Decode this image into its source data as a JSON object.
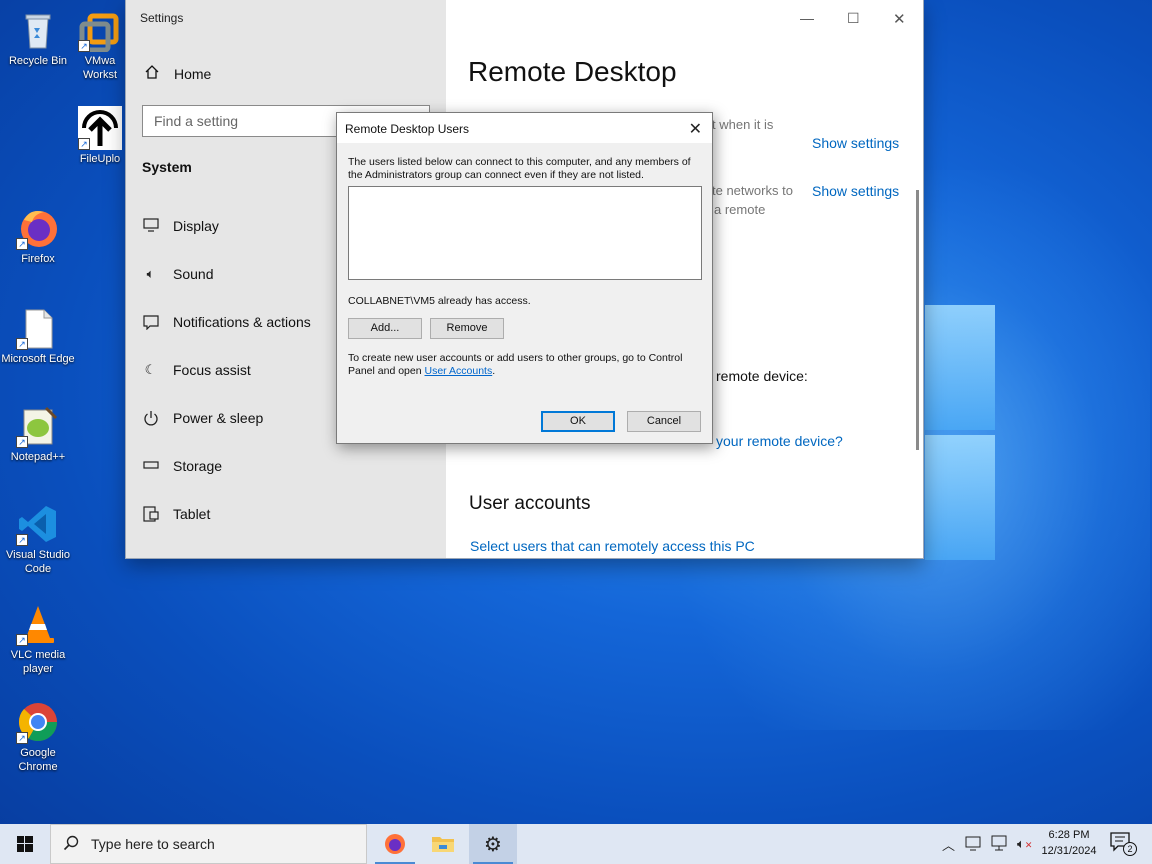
{
  "desktop": {
    "icons": [
      {
        "label": "Recycle Bin"
      },
      {
        "label": "VMware Workstation",
        "visible_label": "VMwa Workst"
      },
      {
        "label": "FileUpload",
        "visible_label": "FileUplo"
      },
      {
        "label": "Firefox"
      },
      {
        "label": "Microsoft Edge"
      },
      {
        "label": "Notepad++"
      },
      {
        "label": "Visual Studio Code"
      },
      {
        "label": "VLC media player"
      },
      {
        "label": "Google Chrome"
      }
    ]
  },
  "settings": {
    "window_title": "Settings",
    "home_label": "Home",
    "search_placeholder": "Find a setting",
    "section_label": "System",
    "nav_items": [
      {
        "label": "Display",
        "icon": "monitor-icon"
      },
      {
        "label": "Sound",
        "icon": "speaker-icon"
      },
      {
        "label": "Notifications & actions",
        "icon": "notification-icon"
      },
      {
        "label": "Focus assist",
        "icon": "moon-icon"
      },
      {
        "label": "Power & sleep",
        "icon": "power-icon"
      },
      {
        "label": "Storage",
        "icon": "storage-icon"
      },
      {
        "label": "Tablet",
        "icon": "tablet-icon"
      }
    ],
    "page_title": "Remote Desktop",
    "partial_text_1": "t when it is",
    "show_settings_1": "Show settings",
    "partial_text_2a": "te networks to",
    "partial_text_2b": "a remote",
    "show_settings_2": "Show settings",
    "partial_text_3": "remote device:",
    "partial_link_4": "your remote device?",
    "user_accounts_heading": "User accounts",
    "select_users_link": "Select users that can remotely access this PC"
  },
  "dialog": {
    "title": "Remote Desktop Users",
    "description": "The users listed below can connect to this computer, and any members of the Administrators group can connect even if they are not listed.",
    "access_text": "COLLABNET\\VM5 already has access.",
    "add_button": "Add...",
    "remove_button": "Remove",
    "note_text": "To create new user accounts or add users to other groups, go to Control Panel and open",
    "note_link": "User Accounts",
    "note_end": ".",
    "ok_button": "OK",
    "cancel_button": "Cancel"
  },
  "taskbar": {
    "search_placeholder": "Type here to search",
    "time": "6:28 PM",
    "date": "12/31/2024",
    "notification_count": "2"
  },
  "colors": {
    "accent": "#0078d7",
    "link": "#0067c0"
  }
}
